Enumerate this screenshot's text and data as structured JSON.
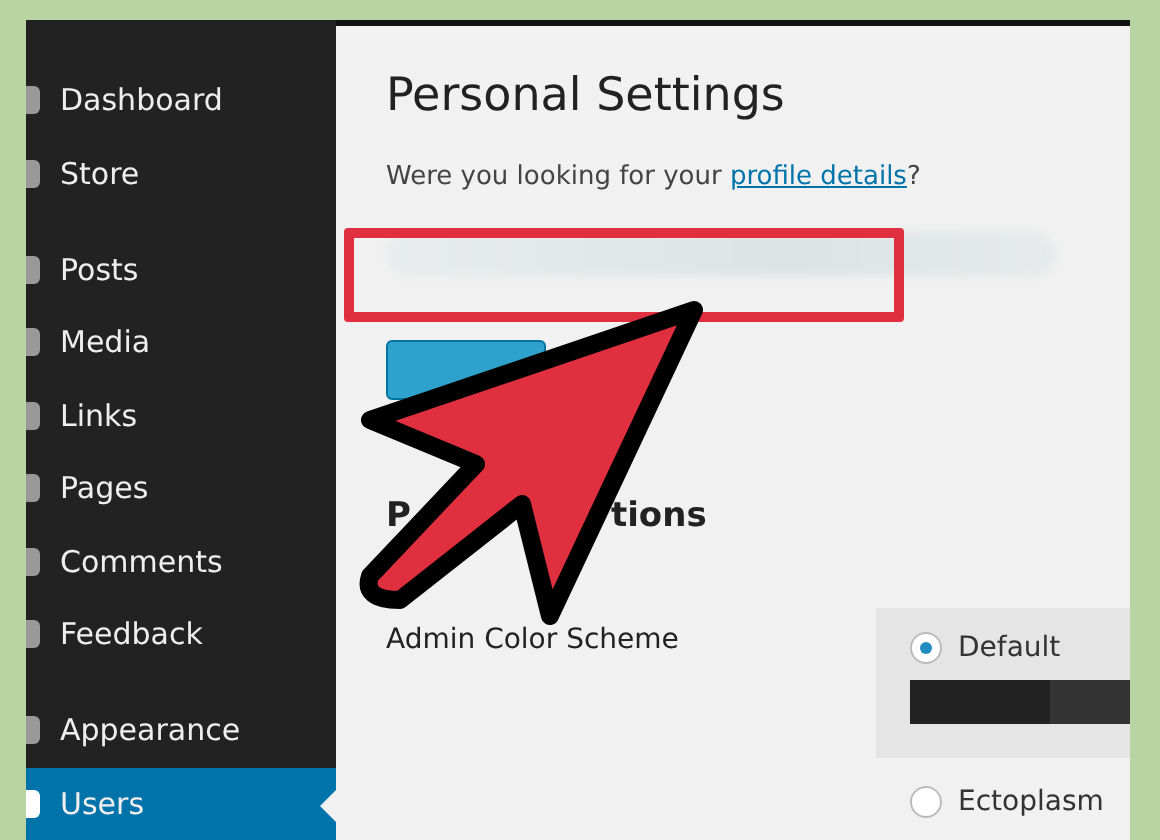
{
  "sidebar": {
    "items": [
      {
        "label": "Dashboard",
        "selected": false,
        "group_end": false
      },
      {
        "label": "Store",
        "selected": false,
        "group_end": true
      },
      {
        "label": "Posts",
        "selected": false,
        "group_end": false
      },
      {
        "label": "Media",
        "selected": false,
        "group_end": false
      },
      {
        "label": "Links",
        "selected": false,
        "group_end": false
      },
      {
        "label": "Pages",
        "selected": false,
        "group_end": false
      },
      {
        "label": "Comments",
        "selected": false,
        "group_end": false
      },
      {
        "label": "Feedback",
        "selected": false,
        "group_end": true
      },
      {
        "label": "Appearance",
        "selected": false,
        "group_end": false
      },
      {
        "label": "Users",
        "selected": true,
        "group_end": false
      }
    ]
  },
  "page_title": "Personal Settings",
  "question": {
    "text": "Were you looking for your ",
    "link": "profile details",
    "end": "?"
  },
  "section_heading": {
    "start": "P",
    "end": "tions"
  },
  "color_scheme": {
    "label": "Admin Color Scheme",
    "options": [
      {
        "label": "Default",
        "selected": true
      },
      {
        "label": "Ectoplasm",
        "selected": false
      }
    ]
  }
}
